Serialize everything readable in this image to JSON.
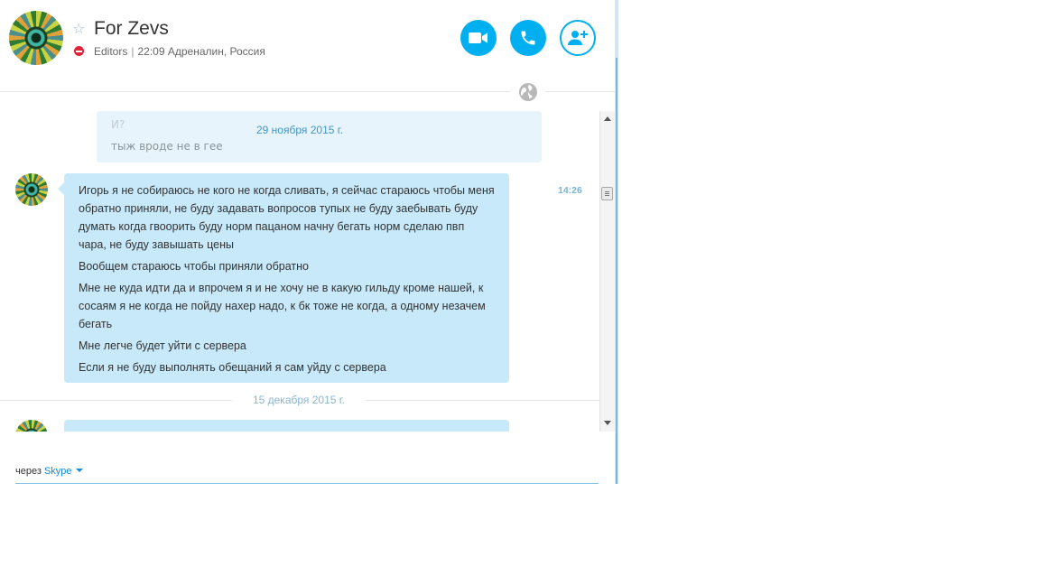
{
  "header": {
    "contact_name": "For Zevs",
    "status_text": "Editors",
    "local_time": "22:09",
    "location": "Адреналин, Россия",
    "favorite_icon": "star-icon",
    "status_icon": "do-not-disturb-icon"
  },
  "actions": {
    "video_icon": "video-call-icon",
    "call_icon": "phone-icon",
    "add_icon": "add-people-icon",
    "accent": "#00aff0"
  },
  "chat": {
    "prev_ghost_top": "И?",
    "prev_ghost_bottom": "тыж вроде не в гее",
    "sticky_date": "29 ноября 2015 г.",
    "message": {
      "time": "14:26",
      "paragraphs": [
        "Игорь я не собираюсь не кого не когда сливать, я сейчас стараюсь чтобы меня обратно приняли, не буду задавать вопросов тупых не буду заебывать буду думать когда гвоорить буду норм пацаном начну бегать норм сделаю пвп чара, не буду завышать цены",
        "Вообщем стараюсь чтобы приняли обратно",
        "Мне не куда идти да и впрочем я и не хочу не в какую гильду кроме нашей, к сосаям я не когда не пойду нахер надо, к бк тоже не когда, а одному незачем бегать",
        "Мне легче будет уйти с сервера",
        "Если я не буду выполнять обещаний я сам уйду с сервера"
      ]
    },
    "date_divider": "15 декабря 2015 г.",
    "bubble_color": "#c7e9fa"
  },
  "footer": {
    "via_label": "через",
    "via_service": "Skype"
  }
}
